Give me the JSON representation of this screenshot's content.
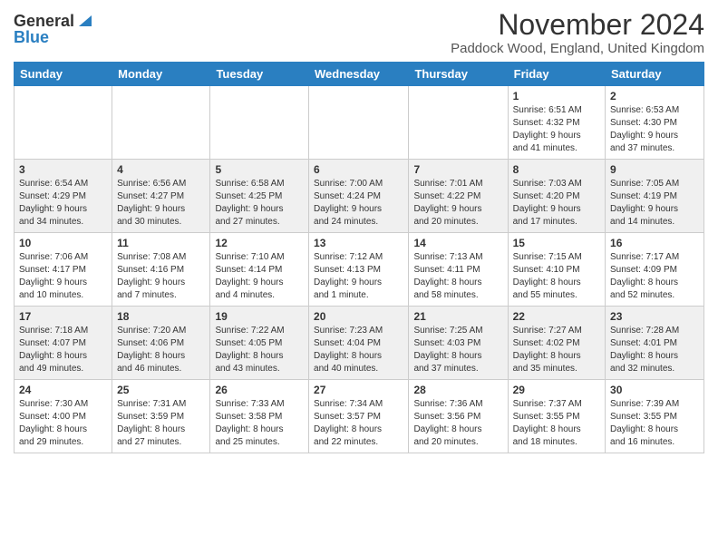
{
  "logo": {
    "general": "General",
    "blue": "Blue",
    "alt": "GeneralBlue logo"
  },
  "title": {
    "month_year": "November 2024",
    "location": "Paddock Wood, England, United Kingdom"
  },
  "calendar": {
    "headers": [
      "Sunday",
      "Monday",
      "Tuesday",
      "Wednesday",
      "Thursday",
      "Friday",
      "Saturday"
    ],
    "weeks": [
      [
        {
          "day": "",
          "info": ""
        },
        {
          "day": "",
          "info": ""
        },
        {
          "day": "",
          "info": ""
        },
        {
          "day": "",
          "info": ""
        },
        {
          "day": "",
          "info": ""
        },
        {
          "day": "1",
          "info": "Sunrise: 6:51 AM\nSunset: 4:32 PM\nDaylight: 9 hours\nand 41 minutes."
        },
        {
          "day": "2",
          "info": "Sunrise: 6:53 AM\nSunset: 4:30 PM\nDaylight: 9 hours\nand 37 minutes."
        }
      ],
      [
        {
          "day": "3",
          "info": "Sunrise: 6:54 AM\nSunset: 4:29 PM\nDaylight: 9 hours\nand 34 minutes."
        },
        {
          "day": "4",
          "info": "Sunrise: 6:56 AM\nSunset: 4:27 PM\nDaylight: 9 hours\nand 30 minutes."
        },
        {
          "day": "5",
          "info": "Sunrise: 6:58 AM\nSunset: 4:25 PM\nDaylight: 9 hours\nand 27 minutes."
        },
        {
          "day": "6",
          "info": "Sunrise: 7:00 AM\nSunset: 4:24 PM\nDaylight: 9 hours\nand 24 minutes."
        },
        {
          "day": "7",
          "info": "Sunrise: 7:01 AM\nSunset: 4:22 PM\nDaylight: 9 hours\nand 20 minutes."
        },
        {
          "day": "8",
          "info": "Sunrise: 7:03 AM\nSunset: 4:20 PM\nDaylight: 9 hours\nand 17 minutes."
        },
        {
          "day": "9",
          "info": "Sunrise: 7:05 AM\nSunset: 4:19 PM\nDaylight: 9 hours\nand 14 minutes."
        }
      ],
      [
        {
          "day": "10",
          "info": "Sunrise: 7:06 AM\nSunset: 4:17 PM\nDaylight: 9 hours\nand 10 minutes."
        },
        {
          "day": "11",
          "info": "Sunrise: 7:08 AM\nSunset: 4:16 PM\nDaylight: 9 hours\nand 7 minutes."
        },
        {
          "day": "12",
          "info": "Sunrise: 7:10 AM\nSunset: 4:14 PM\nDaylight: 9 hours\nand 4 minutes."
        },
        {
          "day": "13",
          "info": "Sunrise: 7:12 AM\nSunset: 4:13 PM\nDaylight: 9 hours\nand 1 minute."
        },
        {
          "day": "14",
          "info": "Sunrise: 7:13 AM\nSunset: 4:11 PM\nDaylight: 8 hours\nand 58 minutes."
        },
        {
          "day": "15",
          "info": "Sunrise: 7:15 AM\nSunset: 4:10 PM\nDaylight: 8 hours\nand 55 minutes."
        },
        {
          "day": "16",
          "info": "Sunrise: 7:17 AM\nSunset: 4:09 PM\nDaylight: 8 hours\nand 52 minutes."
        }
      ],
      [
        {
          "day": "17",
          "info": "Sunrise: 7:18 AM\nSunset: 4:07 PM\nDaylight: 8 hours\nand 49 minutes."
        },
        {
          "day": "18",
          "info": "Sunrise: 7:20 AM\nSunset: 4:06 PM\nDaylight: 8 hours\nand 46 minutes."
        },
        {
          "day": "19",
          "info": "Sunrise: 7:22 AM\nSunset: 4:05 PM\nDaylight: 8 hours\nand 43 minutes."
        },
        {
          "day": "20",
          "info": "Sunrise: 7:23 AM\nSunset: 4:04 PM\nDaylight: 8 hours\nand 40 minutes."
        },
        {
          "day": "21",
          "info": "Sunrise: 7:25 AM\nSunset: 4:03 PM\nDaylight: 8 hours\nand 37 minutes."
        },
        {
          "day": "22",
          "info": "Sunrise: 7:27 AM\nSunset: 4:02 PM\nDaylight: 8 hours\nand 35 minutes."
        },
        {
          "day": "23",
          "info": "Sunrise: 7:28 AM\nSunset: 4:01 PM\nDaylight: 8 hours\nand 32 minutes."
        }
      ],
      [
        {
          "day": "24",
          "info": "Sunrise: 7:30 AM\nSunset: 4:00 PM\nDaylight: 8 hours\nand 29 minutes."
        },
        {
          "day": "25",
          "info": "Sunrise: 7:31 AM\nSunset: 3:59 PM\nDaylight: 8 hours\nand 27 minutes."
        },
        {
          "day": "26",
          "info": "Sunrise: 7:33 AM\nSunset: 3:58 PM\nDaylight: 8 hours\nand 25 minutes."
        },
        {
          "day": "27",
          "info": "Sunrise: 7:34 AM\nSunset: 3:57 PM\nDaylight: 8 hours\nand 22 minutes."
        },
        {
          "day": "28",
          "info": "Sunrise: 7:36 AM\nSunset: 3:56 PM\nDaylight: 8 hours\nand 20 minutes."
        },
        {
          "day": "29",
          "info": "Sunrise: 7:37 AM\nSunset: 3:55 PM\nDaylight: 8 hours\nand 18 minutes."
        },
        {
          "day": "30",
          "info": "Sunrise: 7:39 AM\nSunset: 3:55 PM\nDaylight: 8 hours\nand 16 minutes."
        }
      ]
    ]
  }
}
